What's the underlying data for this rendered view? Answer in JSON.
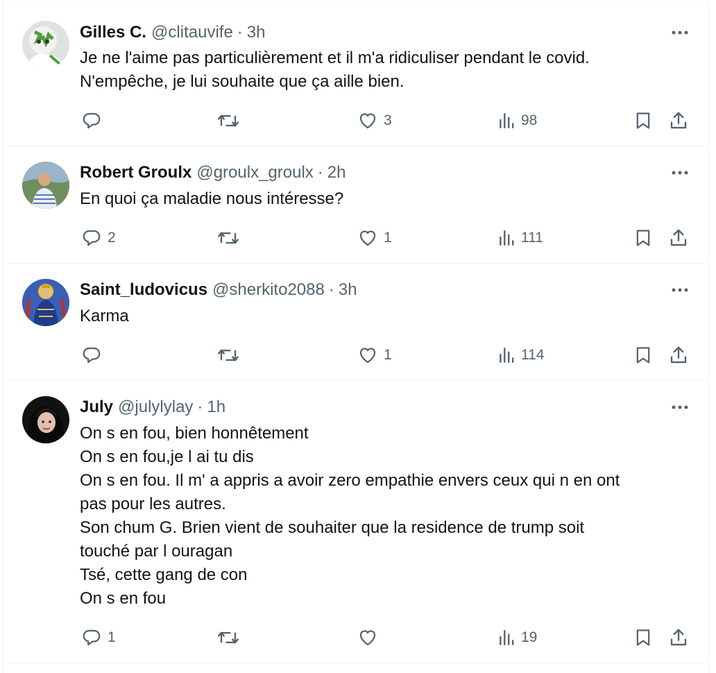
{
  "tweets": [
    {
      "name": "Gilles C.",
      "handle": "@clitauvife",
      "time": "3h",
      "lines": [
        "Je ne l'aime pas particulièrement et il m'a ridiculiser pendant le covid.",
        "N'empêche, je lui souhaite que ça aille bien."
      ],
      "replies": "",
      "retweets": "",
      "likes": "3",
      "views": "98"
    },
    {
      "name": "Robert Groulx",
      "handle": "@groulx_groulx",
      "time": "2h",
      "lines": [
        "En quoi ça maladie nous intéresse?"
      ],
      "replies": "2",
      "retweets": "",
      "likes": "1",
      "views": "111"
    },
    {
      "name": "Saint_ludovicus",
      "handle": "@sherkito2088",
      "time": "3h",
      "lines": [
        "Karma"
      ],
      "replies": "",
      "retweets": "",
      "likes": "1",
      "views": "114"
    },
    {
      "name": "July",
      "handle": "@julylylay",
      "time": "1h",
      "lines": [
        "On s en fou, bien honnêtement",
        "On s en fou,je l ai tu dis",
        "On s en fou. Il m' a appris a avoir zero empathie envers ceux qui n en ont",
        "pas pour les autres.",
        "Son chum G. Brien vient de souhaiter que la residence de trump soit",
        "touché par l ouragan",
        "Tsé, cette gang de con",
        "On s en fou"
      ],
      "replies": "1",
      "retweets": "",
      "likes": "",
      "views": "19"
    }
  ],
  "separator": "·",
  "icons": {
    "reply": "reply-icon",
    "retweet": "retweet-icon",
    "like": "heart-icon",
    "views": "views-icon",
    "bookmark": "bookmark-icon",
    "share": "share-icon",
    "more": "more-icon"
  },
  "colors": {
    "text": "#0f1419",
    "secondary": "#536471",
    "border": "#eff3f4"
  }
}
